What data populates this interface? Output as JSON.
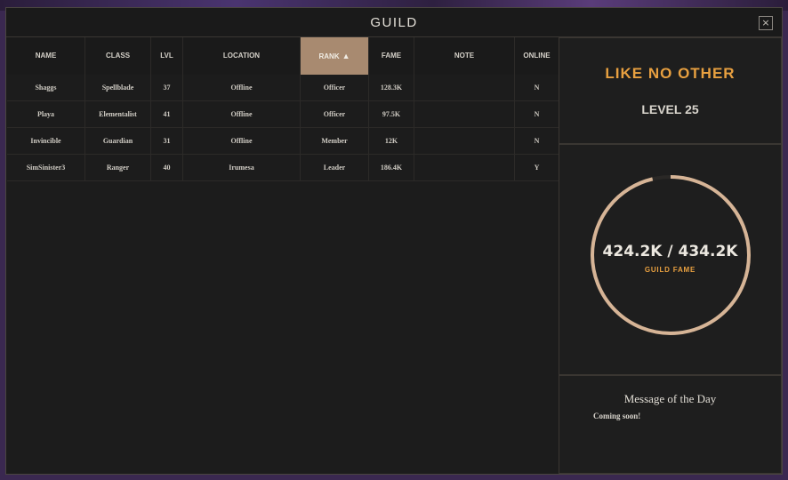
{
  "window": {
    "title": "GUILD",
    "close_label": "×"
  },
  "table": {
    "columns": [
      "NAME",
      "CLASS",
      "LVL",
      "LOCATION",
      "RANK",
      "FAME",
      "NOTE",
      "ONLINE"
    ],
    "sort_indicator": "▲",
    "sorted_column": "RANK",
    "rows": [
      {
        "name": "Shaggs",
        "class": "Spellblade",
        "lvl": "37",
        "location": "Offline",
        "rank": "Officer",
        "fame": "128.3K",
        "note": "",
        "online": "N"
      },
      {
        "name": "Playa",
        "class": "Elementalist",
        "lvl": "41",
        "location": "Offline",
        "rank": "Officer",
        "fame": "97.5K",
        "note": "",
        "online": "N"
      },
      {
        "name": "Invincible",
        "class": "Guardian",
        "lvl": "31",
        "location": "Offline",
        "rank": "Member",
        "fame": "12K",
        "note": "",
        "online": "N"
      },
      {
        "name": "SimSinister3",
        "class": "Ranger",
        "lvl": "40",
        "location": "Irumesa",
        "rank": "Leader",
        "fame": "186.4K",
        "note": "",
        "online": "Y"
      }
    ]
  },
  "guild": {
    "name": "LIKE NO OTHER",
    "level": "LEVEL 25",
    "fame_value": "424.2K / 434.2K",
    "fame_label": "GUILD FAME",
    "fame_progress": 0.977
  },
  "motd": {
    "title": "Message of the Day",
    "text": "Coming soon!"
  },
  "colors": {
    "accent": "#e8a040",
    "active_header": "#a88a70",
    "ring": "#d6b496"
  }
}
